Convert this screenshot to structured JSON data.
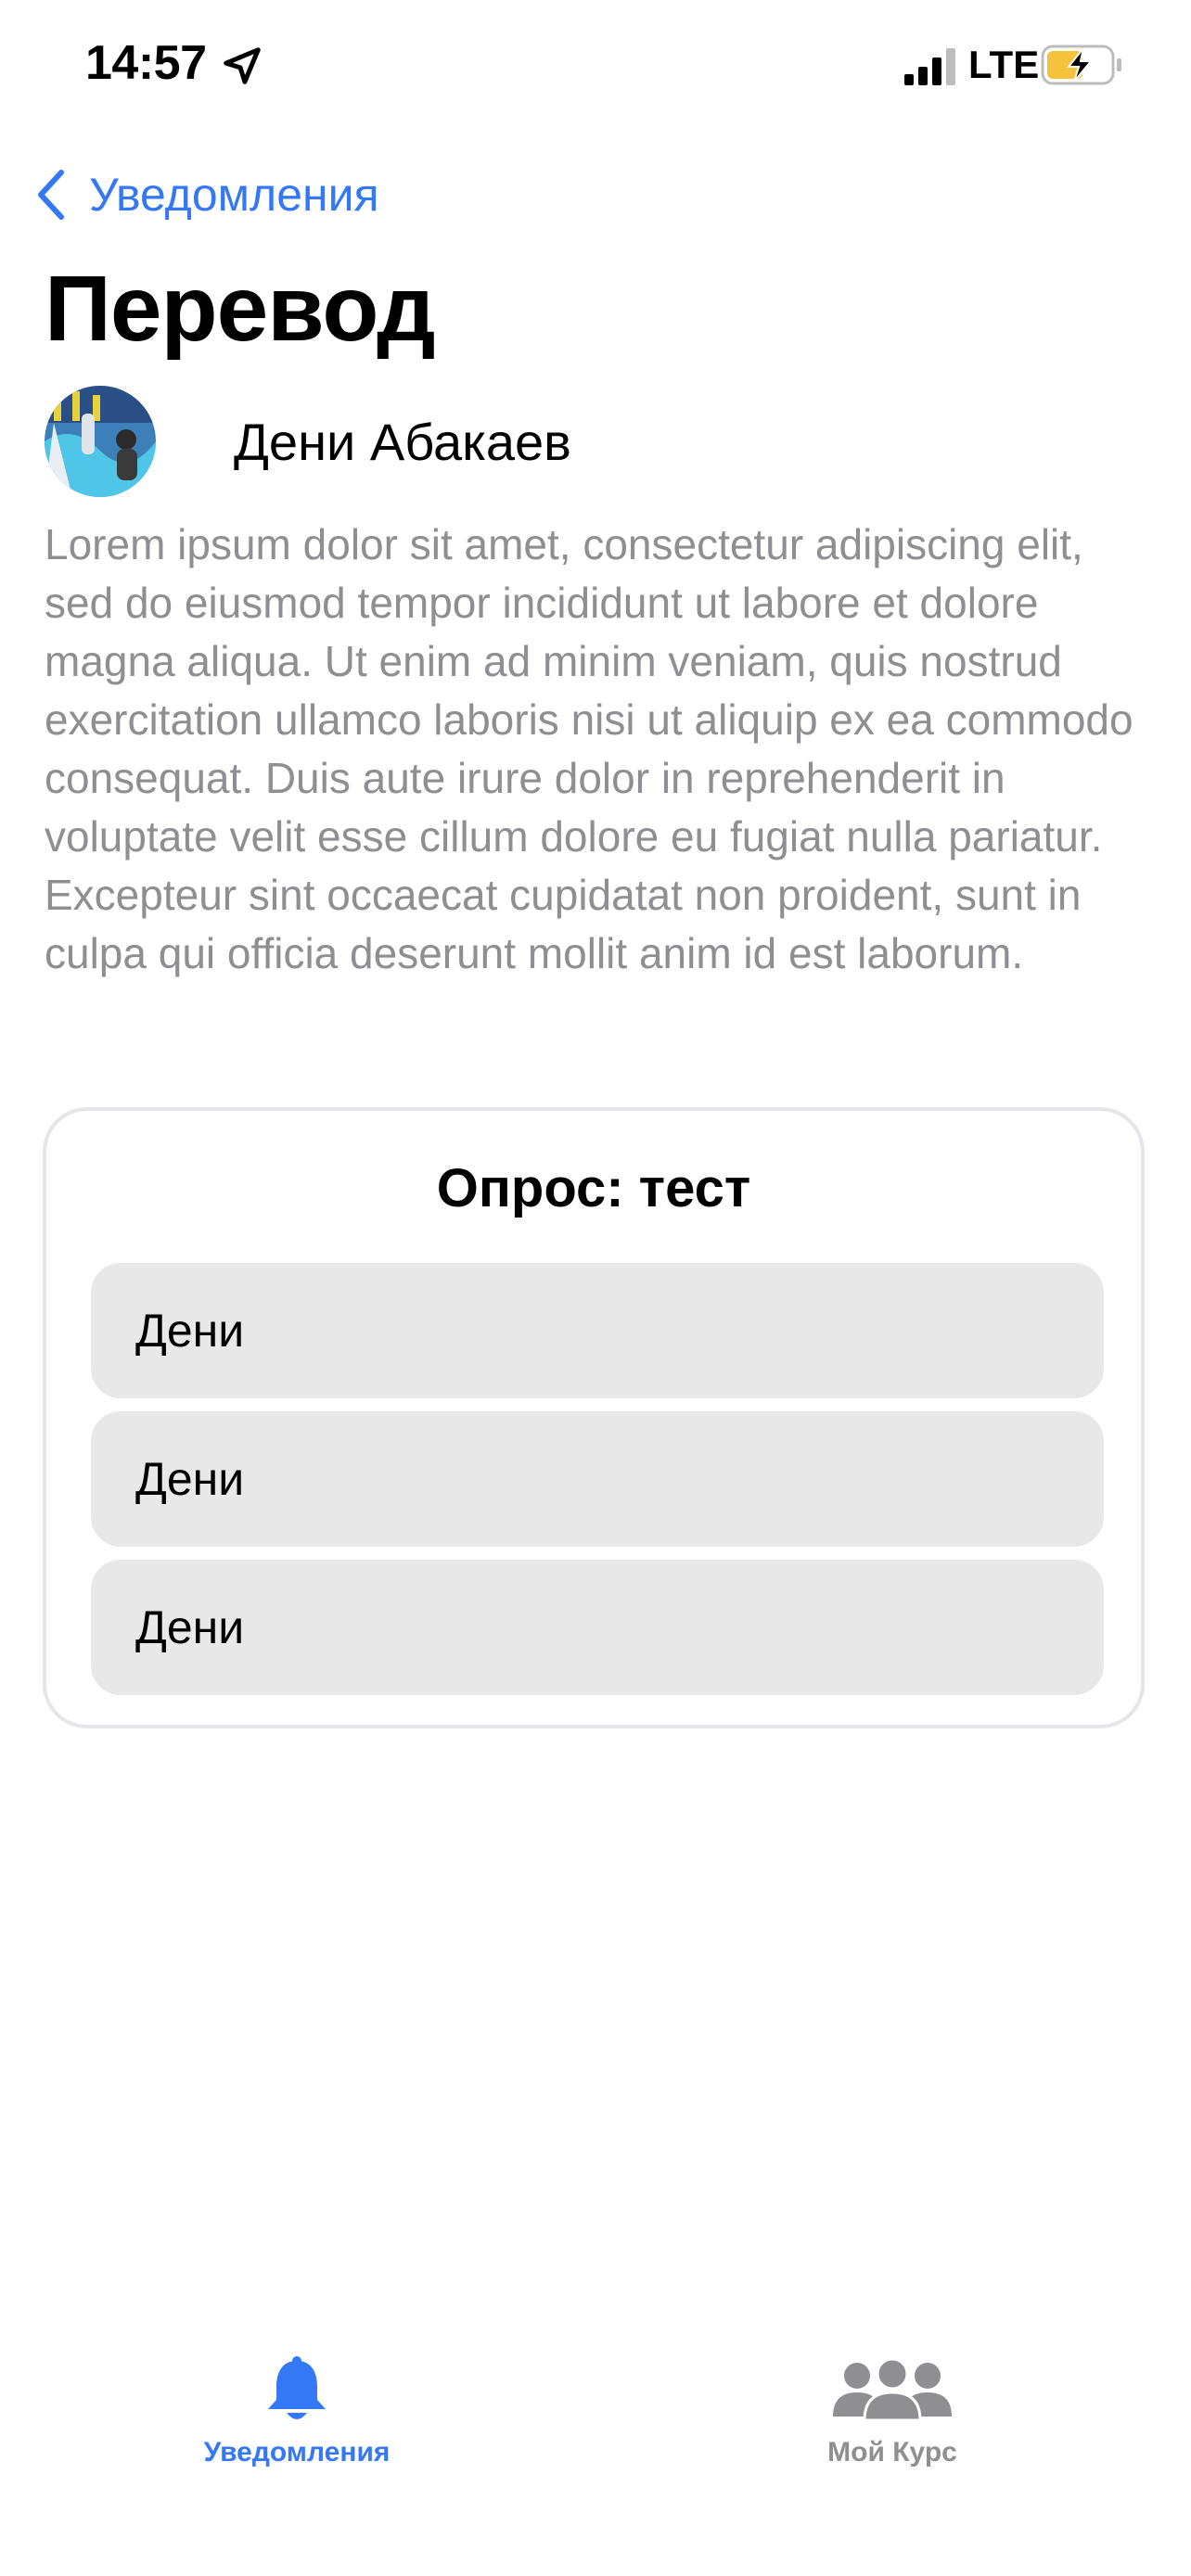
{
  "status_bar": {
    "time": "14:57",
    "network": "LTE"
  },
  "nav": {
    "back_label": "Уведомления"
  },
  "post": {
    "title": "Перевод",
    "author_name": "Дени Абакаев",
    "body": "Lorem ipsum dolor sit amet, consectetur adipiscing elit, sed do eiusmod tempor incididunt ut labore et dolore magna aliqua. Ut enim ad minim veniam, quis nostrud exercitation ullamco laboris nisi ut aliquip ex ea commodo consequat. Duis aute irure dolor in reprehenderit in voluptate velit esse cillum dolore eu fugiat nulla pariatur. Excepteur sint occaecat cupidatat non proident, sunt in culpa qui officia deserunt mollit anim id est laborum."
  },
  "poll": {
    "title": "Опрос: тест",
    "options": [
      {
        "label": "Дени"
      },
      {
        "label": "Дени"
      },
      {
        "label": "Дени"
      }
    ]
  },
  "tabbar": {
    "tabs": [
      {
        "label": "Уведомления",
        "icon": "bell-icon",
        "active": true
      },
      {
        "label": "Мой Курс",
        "icon": "people-icon",
        "active": false
      }
    ]
  },
  "colors": {
    "accent": "#3478f6",
    "secondary_text": "#8e8e93",
    "option_bg": "#e8e8e8",
    "battery_fill": "#f7c23b"
  }
}
